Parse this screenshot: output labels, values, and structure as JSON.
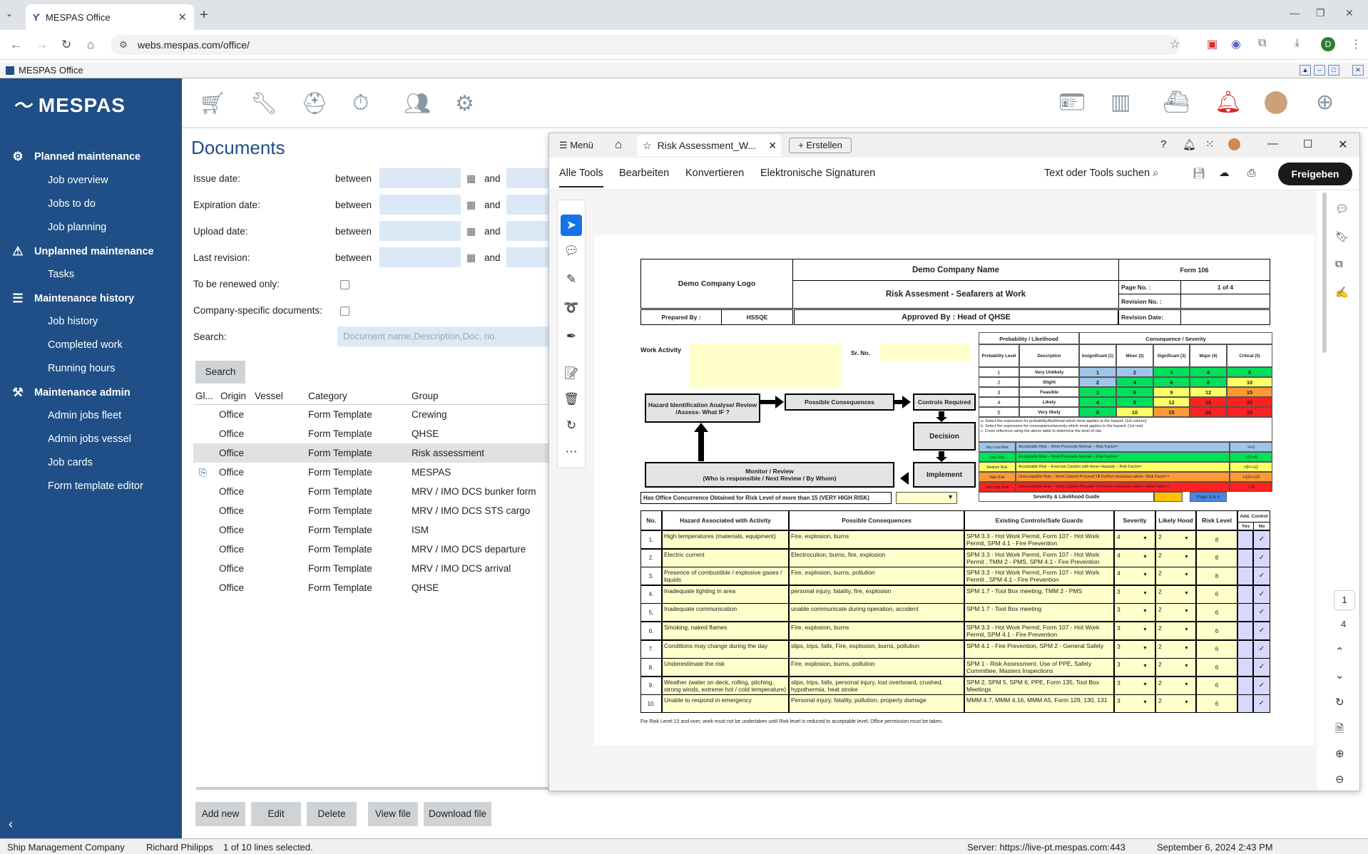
{
  "browser": {
    "tab_title": "MESPAS Office",
    "url": "webs.mespas.com/office/",
    "profile": "D"
  },
  "app": {
    "window_title": "MESPAS Office",
    "logo": "MESPAS"
  },
  "sidebar": {
    "sections": [
      {
        "label": "Planned maintenance",
        "items": [
          "Job overview",
          "Jobs to do",
          "Job planning"
        ]
      },
      {
        "label": "Unplanned maintenance",
        "items": [
          "Tasks"
        ]
      },
      {
        "label": "Maintenance history",
        "items": [
          "Job history",
          "Completed work",
          "Running hours"
        ]
      },
      {
        "label": "Maintenance admin",
        "items": [
          "Admin jobs fleet",
          "Admin jobs vessel",
          "Job cards",
          "Form template editor"
        ]
      }
    ]
  },
  "documents": {
    "title": "Documents",
    "filters": {
      "issue": "Issue date:",
      "expiration": "Expiration date:",
      "upload": "Upload date:",
      "revision": "Last revision:",
      "between": "between",
      "and": "and",
      "renew": "To be renewed only:",
      "company": "Company-specific documents:",
      "search": "Search:",
      "search_placeholder": "Document name,Description,Doc. no.",
      "search_button": "Search"
    },
    "columns": [
      "Gl...",
      "Origin",
      "Vessel",
      "Category",
      "Group"
    ],
    "rows": [
      {
        "origin": "Office",
        "category": "Form Template",
        "group": "Crewing"
      },
      {
        "origin": "Office",
        "category": "Form Template",
        "group": "QHSE"
      },
      {
        "origin": "Office",
        "category": "Form Template",
        "group": "Risk assessment"
      },
      {
        "origin": "Office",
        "category": "Form Template",
        "group": "MESPAS"
      },
      {
        "origin": "Office",
        "category": "Form Template",
        "group": "MRV / IMO DCS bunker form"
      },
      {
        "origin": "Office",
        "category": "Form Template",
        "group": "MRV / IMO DCS STS cargo"
      },
      {
        "origin": "Office",
        "category": "Form Template",
        "group": "ISM"
      },
      {
        "origin": "Office",
        "category": "Form Template",
        "group": "MRV / IMO DCS departure"
      },
      {
        "origin": "Office",
        "category": "Form Template",
        "group": "MRV / IMO DCS arrival"
      },
      {
        "origin": "Office",
        "category": "Form Template",
        "group": "QHSE"
      }
    ],
    "buttons": [
      "Add new",
      "Edit",
      "Delete",
      "View file",
      "Download file"
    ]
  },
  "status": {
    "company": "Ship Management Company",
    "user": "Richard Philipps",
    "selection": "1 of 10 lines selected.",
    "server": "Server: https://live-pt.mespas.com:443",
    "datetime": "September 6, 2024 2:43 PM"
  },
  "pdf": {
    "menu": "Menü",
    "tab_title": "Risk Assessment_W...",
    "create": "Erstellen",
    "tabs": [
      "Alle Tools",
      "Bearbeiten",
      "Konvertieren",
      "Elektronische Signaturen"
    ],
    "search": "Text oder Tools suchen",
    "share": "Freigeben",
    "page_current": "1",
    "page_total": "4"
  },
  "form": {
    "company": "Demo Company Name",
    "logo": "Demo Company Logo",
    "form_no": "Form 106",
    "title": "Risk Assesment - Seafarers at Work",
    "page_no_label": "Page No. :",
    "page_no": "1 of 4",
    "revision_no": "Revision No. :",
    "revision_date": "Revision Date:",
    "prepared_by": "Prepared By :",
    "prepared_val": "HSSQE",
    "approved": "Approved By : Head of QHSE",
    "work_activity": "Work Activity",
    "sr_no": "Sr. No.",
    "matrix_head1": "Probability / Likelihood",
    "matrix_head2": "Consequence / Severity",
    "matrix_cols": [
      "Probability Level",
      "Description",
      "Insignificant (1)",
      "Minor (2)",
      "Significant (3)",
      "Major (4)",
      "Critical (5)"
    ],
    "matrix_rows": [
      {
        "level": "1",
        "desc": "Very Unlikely",
        "vals": [
          "1",
          "2",
          "3",
          "4",
          "5"
        ]
      },
      {
        "level": "2",
        "desc": "Slight",
        "vals": [
          "2",
          "4",
          "6",
          "8",
          "10"
        ]
      },
      {
        "level": "3",
        "desc": "Feasible",
        "vals": [
          "3",
          "6",
          "9",
          "12",
          "15"
        ]
      },
      {
        "level": "4",
        "desc": "Likely",
        "vals": [
          "4",
          "8",
          "12",
          "16",
          "20"
        ]
      },
      {
        "level": "5",
        "desc": "Very likely",
        "vals": [
          "5",
          "10",
          "15",
          "20",
          "25"
        ]
      }
    ],
    "matrix_notes": "a. Select the expression for probability/likelihood which most applies to the hazard. (1st column)\nb. Select the expression for consequence/severity which most applies to the hazard. (1st row)\nc. Cross reference using the above table to determine the level of risk.",
    "risk_levels": [
      {
        "label": "Very Low Risk",
        "text": "Acceptable Risk – Work Proceeds Normal – Risk Factor=",
        "range": "<=2",
        "color": "#9fc5e8"
      },
      {
        "label": "Low Risk",
        "text": "Acceptable Risk – Work Proceeds Normal – Risk Factor=",
        "range": ">2<=8",
        "color": "#00e05a"
      },
      {
        "label": "Medium Risk",
        "text": "Acceptable Risk – Exercise Caution with these Hazards – Risk Factor=",
        "range": ">8<=12",
        "color": "#ffff66"
      },
      {
        "label": "High Risk",
        "text": "Unacceptable Risk – Work Cannot Proceed Till Further measures taken– Risk Factor =",
        "range": ">12<=15",
        "color": "#ff9933"
      },
      {
        "label": "Very High Risk",
        "text": "Unacceptable Risk – Work Cannot Proceed Till Further measures taken– Risk Factor =",
        "range": ">15",
        "color": "#ff2020"
      }
    ],
    "guide": "Severity & Likelihood Guide",
    "page_link": "Page 3 & 4",
    "flow": {
      "hazard": "Hazard Identification Analyse/ Review /Assess- What IF ?",
      "consequences": "Possible Consequences",
      "controls": "Controls Required",
      "decision": "Decision",
      "implement": "Implement",
      "monitor": "Monitor / Review\n(Who is responsible / Next Review / By Whom)"
    },
    "concurrence": "Has Office Concurrence Obtained for Risk Level of more than 15 (VERY HIGH RISK)",
    "table_head": [
      "No.",
      "Hazard Associated with Activity",
      "Possible Consequences",
      "Existing Controls/Safe Guards",
      "Severity",
      "Likely Hood",
      "Risk Level",
      "Add. Control",
      "Yes",
      "No"
    ],
    "hazards": [
      {
        "no": "1.",
        "hazard": "High temperatures (materials, equipment)",
        "cons": "Fire, explosion, burns",
        "ctrl": "SPM 3.3 - Hot Work Permit, Form 107 - Hot Work Permit, SPM 4.1 - Fire Prevention",
        "sev": "4",
        "lik": "2",
        "risk": "8"
      },
      {
        "no": "2.",
        "hazard": "Electric current",
        "cons": "Electrocution, burns, fire, explosion",
        "ctrl": "SPM 3.3 - Hot Work Permit, Form 107 - Hot Work Permit , TMM 2 - PMS, SPM 4.1 - Fire Prevention",
        "sev": "4",
        "lik": "2",
        "risk": "8"
      },
      {
        "no": "3.",
        "hazard": "Presence of combustible / explosive gases / liquids",
        "cons": "Fire, explosion, burns, pollution",
        "ctrl": "SPM 3.3 - Hot Work Permit, Form 107 - Hot Work Permit , SPM 4.1 - Fire Prevention",
        "sev": "4",
        "lik": "2",
        "risk": "8"
      },
      {
        "no": "4.",
        "hazard": "Inadequate lighting in area",
        "cons": "personal injury, fatality, fire, explosion",
        "ctrl": "SPM 1.7 - Tool Box meeting, TMM 2 - PMS",
        "sev": "3",
        "lik": "2",
        "risk": "6"
      },
      {
        "no": "5.",
        "hazard": "Inadequate communication",
        "cons": "unable communicate during operation, accident",
        "ctrl": "SPM 1.7 - Tool Box meeting",
        "sev": "3",
        "lik": "2",
        "risk": "6"
      },
      {
        "no": "6.",
        "hazard": "Smoking, naked flames",
        "cons": "Fire, explosion, burns",
        "ctrl": "SPM 3.3 - Hot Work Permit, Form 107 - Hot Work Permit, SPM 4.1 - Fire Prevention",
        "sev": "3",
        "lik": "2",
        "risk": "6"
      },
      {
        "no": "7.",
        "hazard": "Conditions may change during the day",
        "cons": "slips, trips, falls, Fire, explosion, burns, pollution",
        "ctrl": "SPM 4.1 - Fire Prevention, SPM 2 - General Safety",
        "sev": "3",
        "lik": "2",
        "risk": "6"
      },
      {
        "no": "8.",
        "hazard": "Underestimate the risk",
        "cons": "Fire, explosion, burns, pollution",
        "ctrl": "SPM 1 - Risk Assessment, Use of PPE, Safety Committee, Masters Inspections",
        "sev": "3",
        "lik": "2",
        "risk": "6"
      },
      {
        "no": "9.",
        "hazard": "Weather (water on deck, rolling, pitching, strong winds, extreme hot / cold temperature)",
        "cons": "slips, trips, falls, personal injury, lost overboard, crushed, hypothermia, heat stroke",
        "ctrl": "SPM 2, SPM 5, SPM 6, PPE, Form 135, Tool Box Meetings",
        "sev": "3",
        "lik": "2",
        "risk": "6"
      },
      {
        "no": "10.",
        "hazard": "Unable to respond in emergency",
        "cons": "Personal injury, fatality, pollution, property damage",
        "ctrl": "MMM 4.7, MMM 4.16, MMM A5, Form 129, 130, 131",
        "sev": "3",
        "lik": "2",
        "risk": "6"
      }
    ],
    "footnote": "For Risk Level 15 and over, work must not be undertaken until Risk level is reduced to acceptable level; Office permission must be taken."
  }
}
